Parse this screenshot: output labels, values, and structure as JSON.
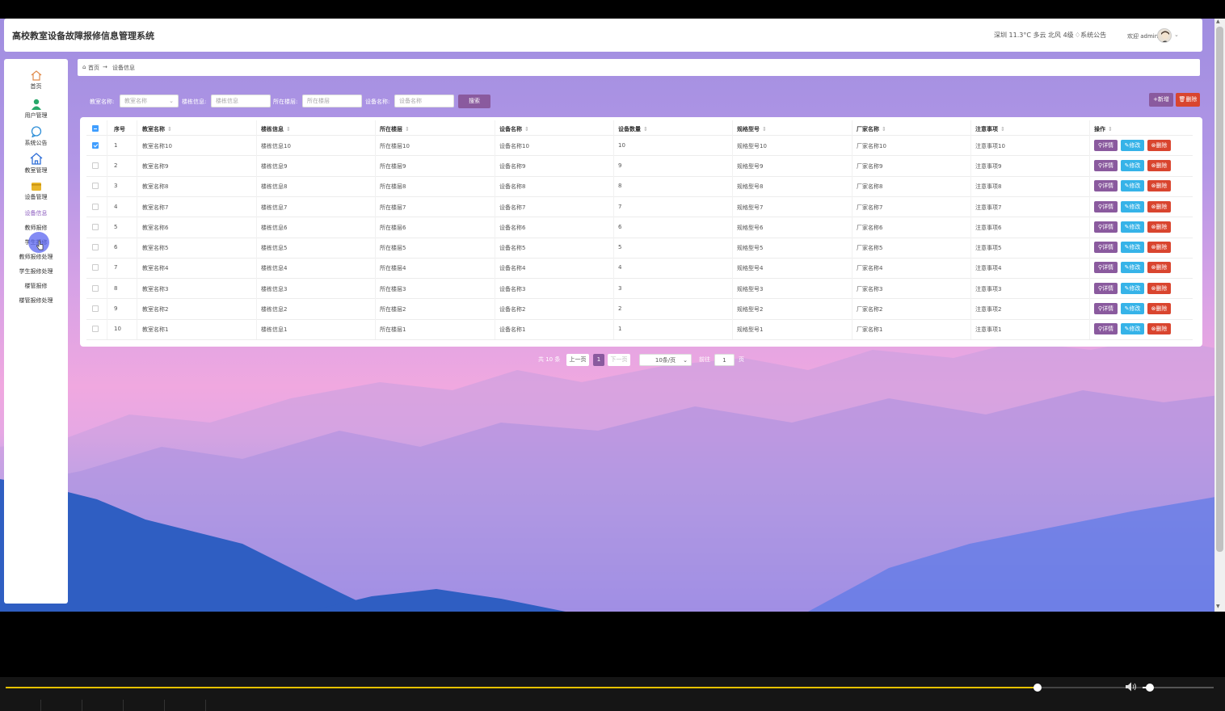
{
  "header": {
    "app_title": "高校教室设备故障报修信息管理系统",
    "weather": "深圳 11.3°C 多云 北风 4级",
    "notice": "系统公告",
    "welcome": "欢迎 admin"
  },
  "sidebar": {
    "items": [
      {
        "label": "首页",
        "icon": "home-icon"
      },
      {
        "label": "用户管理",
        "icon": "user-icon"
      },
      {
        "label": "系统公告",
        "icon": "chat-icon"
      },
      {
        "label": "教室管理",
        "icon": "house-icon"
      },
      {
        "label": "设备管理",
        "icon": "wallet-icon"
      }
    ],
    "subitems": [
      {
        "label": "设备信息",
        "active": true
      },
      {
        "label": "教师报修"
      },
      {
        "label": "学生报修"
      },
      {
        "label": "教师报修处理"
      },
      {
        "label": "学生报修处理"
      },
      {
        "label": "楼管报修"
      },
      {
        "label": "楼管报修处理"
      }
    ]
  },
  "breadcrumb": {
    "home": "首页",
    "separator": "→",
    "current": "设备信息"
  },
  "filters": [
    {
      "label": "教室名称:",
      "placeholder": "教室名称",
      "has_dropdown": true
    },
    {
      "label": "楼栋信息:",
      "placeholder": "楼栋信息"
    },
    {
      "label": "所在楼层:",
      "placeholder": "所在楼层"
    },
    {
      "label": "设备名称:",
      "placeholder": "设备名称"
    }
  ],
  "actions": {
    "search": "搜索",
    "add": "+新增",
    "batch_delete": "删除"
  },
  "table": {
    "columns": [
      "序号",
      "教室名称",
      "楼栋信息",
      "所在楼层",
      "设备名称",
      "设备数量",
      "规格型号",
      "厂家名称",
      "注意事项",
      "操作"
    ],
    "rows": [
      {
        "no": "1",
        "room": "教室名称10",
        "building": "楼栋信息10",
        "floor": "所在楼层10",
        "device": "设备名称10",
        "qty": "10",
        "model": "规格型号10",
        "vendor": "厂家名称10",
        "note": "注意事项10",
        "checked": true
      },
      {
        "no": "2",
        "room": "教室名称9",
        "building": "楼栋信息9",
        "floor": "所在楼层9",
        "device": "设备名称9",
        "qty": "9",
        "model": "规格型号9",
        "vendor": "厂家名称9",
        "note": "注意事项9"
      },
      {
        "no": "3",
        "room": "教室名称8",
        "building": "楼栋信息8",
        "floor": "所在楼层8",
        "device": "设备名称8",
        "qty": "8",
        "model": "规格型号8",
        "vendor": "厂家名称8",
        "note": "注意事项8"
      },
      {
        "no": "4",
        "room": "教室名称7",
        "building": "楼栋信息7",
        "floor": "所在楼层7",
        "device": "设备名称7",
        "qty": "7",
        "model": "规格型号7",
        "vendor": "厂家名称7",
        "note": "注意事项7"
      },
      {
        "no": "5",
        "room": "教室名称6",
        "building": "楼栋信息6",
        "floor": "所在楼层6",
        "device": "设备名称6",
        "qty": "6",
        "model": "规格型号6",
        "vendor": "厂家名称6",
        "note": "注意事项6"
      },
      {
        "no": "6",
        "room": "教室名称5",
        "building": "楼栋信息5",
        "floor": "所在楼层5",
        "device": "设备名称5",
        "qty": "5",
        "model": "规格型号5",
        "vendor": "厂家名称5",
        "note": "注意事项5"
      },
      {
        "no": "7",
        "room": "教室名称4",
        "building": "楼栋信息4",
        "floor": "所在楼层4",
        "device": "设备名称4",
        "qty": "4",
        "model": "规格型号4",
        "vendor": "厂家名称4",
        "note": "注意事项4"
      },
      {
        "no": "8",
        "room": "教室名称3",
        "building": "楼栋信息3",
        "floor": "所在楼层3",
        "device": "设备名称3",
        "qty": "3",
        "model": "规格型号3",
        "vendor": "厂家名称3",
        "note": "注意事项3"
      },
      {
        "no": "9",
        "room": "教室名称2",
        "building": "楼栋信息2",
        "floor": "所在楼层2",
        "device": "设备名称2",
        "qty": "2",
        "model": "规格型号2",
        "vendor": "厂家名称2",
        "note": "注意事项2"
      },
      {
        "no": "10",
        "room": "教室名称1",
        "building": "楼栋信息1",
        "floor": "所在楼层1",
        "device": "设备名称1",
        "qty": "1",
        "model": "规格型号1",
        "vendor": "厂家名称1",
        "note": "注意事项1"
      }
    ],
    "ops": {
      "detail": "详情",
      "edit": "修改",
      "delete": "删除"
    }
  },
  "pagination": {
    "total": "共 10 条",
    "prev": "上一页",
    "current": "1",
    "next": "下一页",
    "page_size": "10条/页",
    "goto": "前往",
    "goto_value": "1",
    "page_unit": "页"
  },
  "player": {
    "progress": 0.855,
    "volume": 0.1
  },
  "colors": {
    "accent": "#8a5a9e",
    "edit": "#36b3e8",
    "danger": "#d9452f",
    "checkbox": "#409eff"
  }
}
